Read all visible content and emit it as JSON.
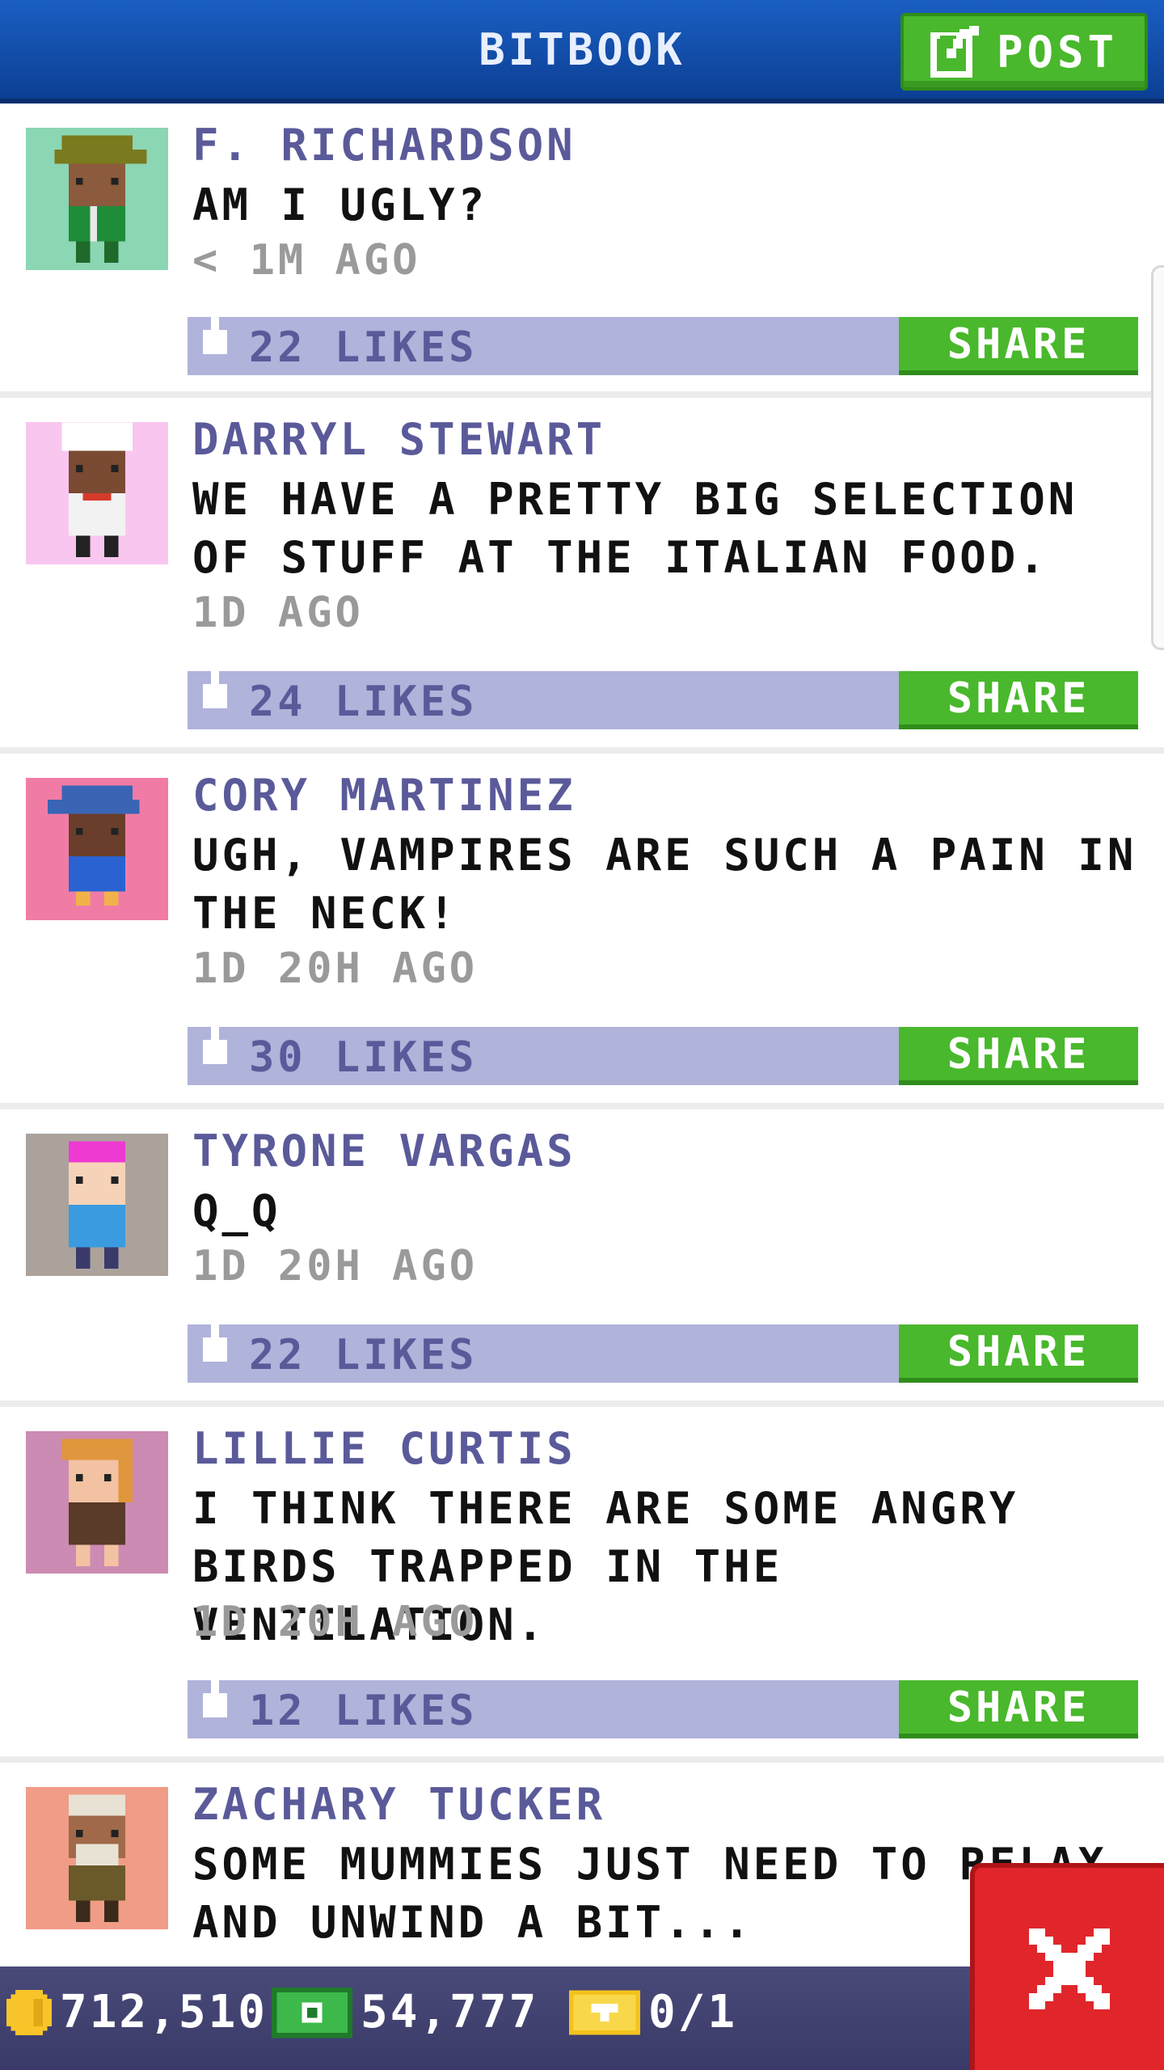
{
  "header": {
    "title": "BITBOOK",
    "post_label": "POST"
  },
  "posts": [
    {
      "author": "F. RICHARDSON",
      "message": "AM I UGLY?",
      "time": "< 1M AGO",
      "likes": "22 LIKES",
      "share_label": "SHARE",
      "avatar_bg": "#8bd6b3"
    },
    {
      "author": "DARRYL STEWART",
      "message": "WE HAVE A PRETTY BIG SELECTION OF STUFF AT THE ITALIAN FOOD.",
      "time": "1D AGO",
      "likes": "24 LIKES",
      "share_label": "SHARE",
      "avatar_bg": "#f9c6f0"
    },
    {
      "author": "CORY MARTINEZ",
      "message": "UGH, VAMPIRES ARE SUCH A PAIN IN THE NECK!",
      "time": "1D 20H AGO",
      "likes": "30 LIKES",
      "share_label": "SHARE",
      "avatar_bg": "#f07ca6"
    },
    {
      "author": "TYRONE VARGAS",
      "message": "Q_Q",
      "time": "1D 20H AGO",
      "likes": "22 LIKES",
      "share_label": "SHARE",
      "avatar_bg": "#aca29c"
    },
    {
      "author": "LILLIE CURTIS",
      "message": "I THINK THERE ARE SOME ANGRY BIRDS TRAPPED IN THE VENTILATION.",
      "time": "1D 20H AGO",
      "likes": "12 LIKES",
      "share_label": "SHARE",
      "avatar_bg": "#cc8bb2"
    },
    {
      "author": "ZACHARY TUCKER",
      "message": "SOME MUMMIES JUST NEED TO RELAX AND UNWIND A BIT...",
      "time": "",
      "likes": "",
      "share_label": "",
      "avatar_bg": "#f09c86"
    }
  ],
  "footer": {
    "coins": "712,510",
    "bux": "54,777",
    "tickets": "0/1"
  },
  "colors": {
    "header": "#0f4aa6",
    "accent_green": "#49b82c",
    "likebar": "#b0b3da",
    "author_text": "#5a5a9a",
    "close_red": "#e0262b"
  },
  "icons": [
    "post-edit-icon",
    "like-icon",
    "coin-icon",
    "bux-icon",
    "ticket-icon",
    "close-icon"
  ]
}
